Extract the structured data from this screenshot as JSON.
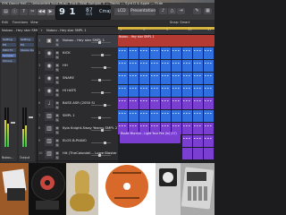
{
  "window": {
    "title": "SYK Dance Hall — Unbounded Soul Music Track: Beat Sampler 3 — Tracks — Synt D & Apple — Flute"
  },
  "toolbar": {
    "lcd": {
      "position": "9 1",
      "tempo": "87",
      "signature": "4/4",
      "key": "Cmaj"
    },
    "mode_buttons": [
      "LCD",
      "Presentation"
    ]
  },
  "subbar": {
    "edit_label": "Edit",
    "functions_label": "Functions",
    "view_label": "View",
    "snap_label": "Snap: Smart"
  },
  "inspector": {
    "header": "Nubou - Hey star SMPL 1",
    "strips": [
      {
        "name": "Nubou...",
        "slots": [
          "Setting",
          "EQ",
          "MIDI FX",
          "Sampler",
          "Chorus"
        ]
      },
      {
        "name": "Output",
        "slots": [
          "Setting",
          "EQ",
          "Stereo Out"
        ]
      }
    ]
  },
  "tracks_header": {
    "label": "Nubou - Hey star SMPL 1"
  },
  "tracks": [
    {
      "num": "1",
      "name": "Nubou - Hey star SMPL 1",
      "icon": "sampler-icon",
      "selected": true
    },
    {
      "num": "2",
      "name": "KICK",
      "icon": "drum-icon",
      "selected": false
    },
    {
      "num": "3",
      "name": "HH",
      "icon": "drum-icon",
      "selected": false
    },
    {
      "num": "4",
      "name": "SNARE",
      "icon": "drum-icon",
      "selected": false
    },
    {
      "num": "5",
      "name": "HI HATS",
      "icon": "drum-icon",
      "selected": false
    },
    {
      "num": "6",
      "name": "BASS ASR (2050 Sl",
      "icon": "bass-icon",
      "selected": false
    },
    {
      "num": "7",
      "name": "SMPL 1",
      "icon": "keys-icon",
      "selected": false
    },
    {
      "num": "8",
      "name": "Kyla Knight-Sway Yearns SMPL 2",
      "icon": "keys-icon",
      "selected": false
    },
    {
      "num": "9",
      "name": "ELOS B-PIANO",
      "icon": "keys-icon",
      "selected": false
    },
    {
      "num": "10",
      "name": "Hit (TheColoniell... Lowe Blaster 3",
      "icon": "keys-icon",
      "selected": false
    }
  ],
  "arrange": {
    "ruler": [
      "1",
      "5",
      "9",
      "13",
      "17"
    ],
    "region_labels": [
      "Nubou - Hey star SMPL 1",
      "Rustic Murmur - Light Your Fire (In) (17)"
    ]
  },
  "colors": {
    "track1": "#d2453c",
    "drums": "#2f6fe0",
    "purple": "#7a3fd1",
    "cycle": "#d7b43e"
  },
  "dock": {
    "items": [
      {
        "name": "record-sleeve-1",
        "label": ""
      },
      {
        "name": "record-label-orange",
        "label": ""
      },
      {
        "name": "sampler-hardware",
        "label": ""
      }
    ]
  }
}
